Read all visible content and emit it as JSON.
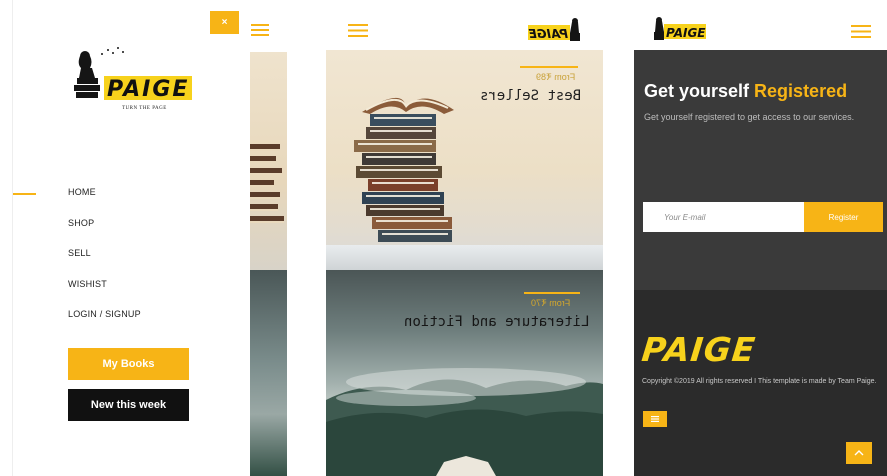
{
  "menu": {
    "close_label": "×",
    "logo_text": "PAIGE",
    "logo_tagline": "TURN THE PAGE",
    "items": [
      {
        "label": "HOME"
      },
      {
        "label": "SHOP"
      },
      {
        "label": "SELL"
      },
      {
        "label": "WISHIST"
      },
      {
        "label": "LOGIN / SIGNUP"
      }
    ],
    "my_books_label": "My Books",
    "new_this_week_label": "New this week"
  },
  "categories": {
    "logo_text": "PAIGE",
    "items": [
      {
        "price": "From ₹89",
        "title": "Best Sellers"
      },
      {
        "price": "From ₹70",
        "title": "Literature and Fiction"
      }
    ]
  },
  "register": {
    "logo_text": "PAIGE",
    "heading_main": "Get yourself",
    "heading_highlight": "Registered",
    "description": "Get yourself registered to get access to our services.",
    "email_placeholder": "Your E-mail",
    "register_button": "Register"
  },
  "footer": {
    "brand": "PAIGE",
    "copyright": "Copyright ©2019 All rights reserved I This template is made by Team Paige."
  },
  "colors": {
    "accent": "#f7b416",
    "dark": "#3a3a3a",
    "footer": "#2b2b2b"
  }
}
